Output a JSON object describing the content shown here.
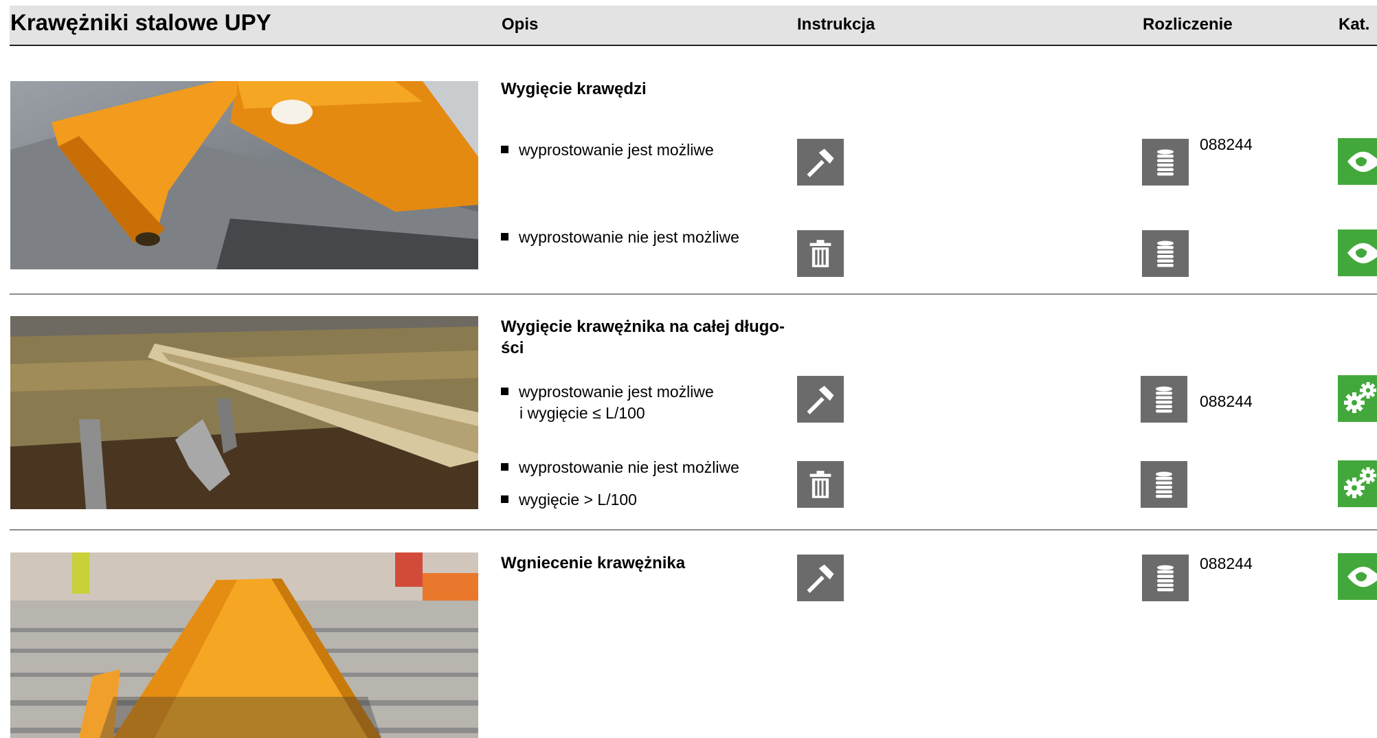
{
  "header": {
    "title": "Krawężniki stalowe UPY",
    "columns": {
      "opis": "Opis",
      "instrukcja": "Instrukcja",
      "rozliczenie": "Rozliczenie",
      "kat": "Kat."
    }
  },
  "sections": [
    {
      "title": "Wygięcie krawędzi",
      "rows": [
        {
          "bullets": [
            "wyprostowanie jest możliwe"
          ],
          "instruction_icon": "hammer-icon",
          "billing_icon": "coin-stack-icon",
          "code": "088244",
          "category_icon": "eye-icon"
        },
        {
          "bullets": [
            "wyprostowanie nie jest możliwe"
          ],
          "instruction_icon": "trash-icon",
          "billing_icon": "coin-stack-icon",
          "code": "",
          "category_icon": "eye-icon"
        }
      ]
    },
    {
      "title": "Wygięcie krawężnika na całej długo-",
      "title_cont": "ści",
      "rows": [
        {
          "bullets": [
            "wyprostowanie jest możliwe"
          ],
          "bullet_cont": "i wygięcie ≤ L/100",
          "instruction_icon": "hammer-icon",
          "billing_icon": "coin-stack-icon",
          "code": "088244",
          "category_icon": "gears-icon"
        },
        {
          "bullets": [
            "wyprostowanie nie jest możliwe",
            "wygięcie > L/100"
          ],
          "instruction_icon": "trash-icon",
          "billing_icon": "coin-stack-icon",
          "code": "",
          "category_icon": "gears-icon"
        }
      ]
    },
    {
      "title": "Wgniecenie krawężnika",
      "rows": [
        {
          "bullets": [],
          "instruction_icon": "hammer-icon",
          "billing_icon": "coin-stack-icon",
          "code": "088244",
          "category_icon": "eye-icon"
        }
      ]
    }
  ],
  "colors": {
    "header_bg": "#e3e3e3",
    "icon_gray": "#6b6b6b",
    "icon_green": "#43a83b",
    "kerb_orange": "#f2a12a"
  }
}
